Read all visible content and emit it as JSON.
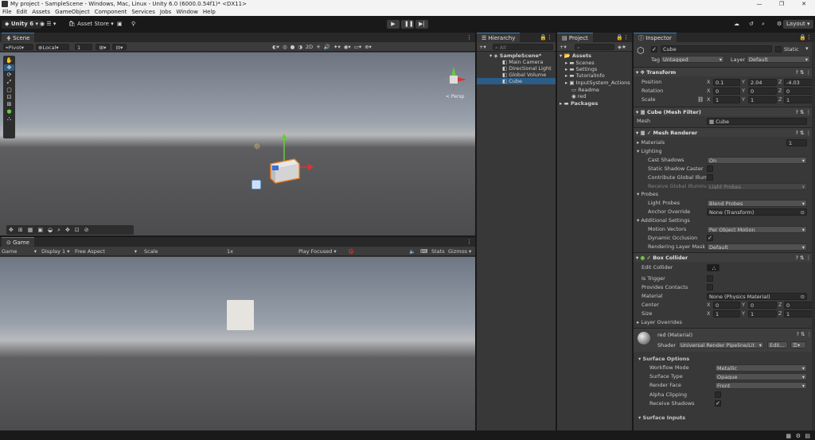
{
  "window": {
    "title": "My project - SampleScene - Windows, Mac, Linux - Unity 6.0 (6000.0.54f1)* <DX11>"
  },
  "menu": [
    "File",
    "Edit",
    "Assets",
    "GameObject",
    "Component",
    "Services",
    "Jobs",
    "Window",
    "Help"
  ],
  "toolbar": {
    "account": "Unity 6",
    "asset_store": "Asset Store",
    "layout": "Layout"
  },
  "scene": {
    "tab": "Scene",
    "pivot": "Pivot",
    "local": "Local",
    "grid_size": "1",
    "persp_label": "< Persp"
  },
  "game": {
    "tab": "Game",
    "mode": "Game",
    "display": "Display 1",
    "aspect": "Free Aspect",
    "scale_label": "Scale",
    "scale_value": "1x",
    "play_focused": "Play Focused",
    "stats": "Stats",
    "gizmos": "Gizmos"
  },
  "hierarchy": {
    "tab": "Hierarchy",
    "search_placeholder": "All",
    "scene": "SampleScene*",
    "items": [
      "Main Camera",
      "Directional Light",
      "Global Volume",
      "Cube"
    ]
  },
  "project": {
    "tab": "Project",
    "assets": "Assets",
    "items": [
      "Scenes",
      "Settings",
      "TutorialInfo",
      "InputSystem_Actions",
      "Readme",
      "red"
    ],
    "packages": "Packages"
  },
  "inspector": {
    "tab": "Inspector",
    "object_name": "Cube",
    "static_label": "Static",
    "tag_label": "Tag",
    "tag_value": "Untagged",
    "layer_label": "Layer",
    "layer_value": "Default",
    "transform": {
      "title": "Transform",
      "position": {
        "label": "Position",
        "x": "0.1",
        "y": "2.04",
        "z": "-4.03"
      },
      "rotation": {
        "label": "Rotation",
        "x": "0",
        "y": "0",
        "z": "0"
      },
      "scale": {
        "label": "Scale",
        "x": "1",
        "y": "1",
        "z": "1"
      }
    },
    "mesh_filter": {
      "title": "Cube (Mesh Filter)",
      "mesh_label": "Mesh",
      "mesh_value": "Cube"
    },
    "mesh_renderer": {
      "title": "Mesh Renderer",
      "materials": "Materials",
      "materials_count": "1",
      "lighting": "Lighting",
      "cast_shadows": "Cast Shadows",
      "cast_shadows_value": "On",
      "static_shadow": "Static Shadow Caster",
      "contribute_gi": "Contribute Global Illumi",
      "receive_gi": "Receive Global Illuminat",
      "receive_gi_value": "Light Probes",
      "probes": "Probes",
      "light_probes": "Light Probes",
      "light_probes_value": "Blend Probes",
      "anchor_override": "Anchor Override",
      "anchor_override_value": "None (Transform)",
      "additional": "Additional Settings",
      "motion_vectors": "Motion Vectors",
      "motion_vectors_value": "Per Object Motion",
      "dynamic_occlusion": "Dynamic Occlusion",
      "rendering_layer": "Rendering Layer Mask",
      "rendering_layer_value": "Default"
    },
    "box_collider": {
      "title": "Box Collider",
      "edit_collider": "Edit Collider",
      "is_trigger": "Is Trigger",
      "provides_contacts": "Provides Contacts",
      "material": "Material",
      "material_value": "None (Physics Material)",
      "center": {
        "label": "Center",
        "x": "0",
        "y": "0",
        "z": "0"
      },
      "size": {
        "label": "Size",
        "x": "1",
        "y": "1",
        "z": "1"
      },
      "layer_overrides": "Layer Overrides"
    },
    "material": {
      "title": "red (Material)",
      "shader_label": "Shader",
      "shader_value": "Universal Render Pipeline/Lit",
      "edit": "Edit...",
      "surface_options": "Surface Options",
      "workflow": "Workflow Mode",
      "workflow_value": "Metallic",
      "surface_type": "Surface Type",
      "surface_type_value": "Opaque",
      "render_face": "Render Face",
      "render_face_value": "Front",
      "alpha_clipping": "Alpha Clipping",
      "receive_shadows": "Receive Shadows",
      "surface_inputs": "Surface Inputs"
    }
  },
  "colors": {
    "accent": "#3a79bb",
    "selection": "#2c5d87",
    "cube_outline": "#f08020",
    "gizmo_green": "#6ac93a",
    "gizmo_red": "#d33",
    "gizmo_blue": "#3b6ed8"
  }
}
